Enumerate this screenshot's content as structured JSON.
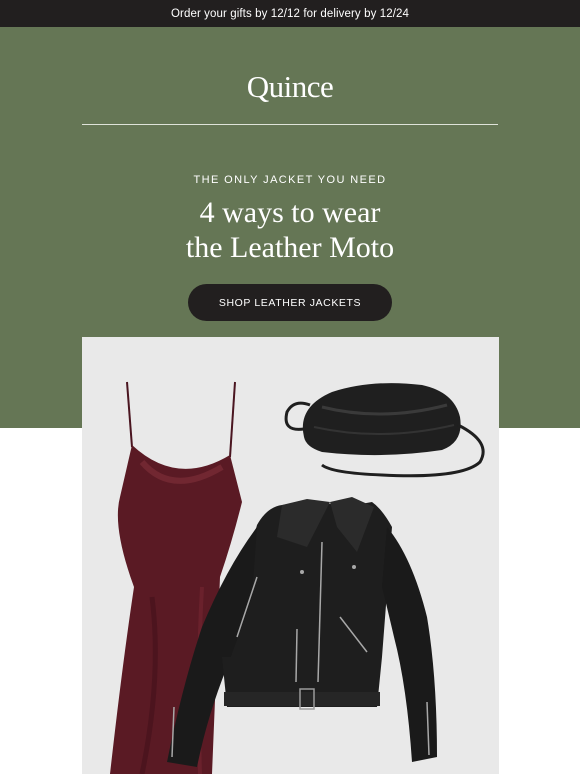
{
  "announcement": {
    "text": "Order your gifts by 12/12 for delivery by 12/24"
  },
  "brand": {
    "logo_text": "Quince"
  },
  "hero": {
    "eyebrow": "THE ONLY JACKET YOU NEED",
    "headline_line1": "4 ways to wear",
    "headline_line2": "the Leather Moto",
    "cta_label": "SHOP LEATHER JACKETS"
  },
  "colors": {
    "announcement_bg": "#221f1f",
    "hero_bg": "#657655",
    "cta_bg": "#221f1f",
    "image_bg": "#e9e9e9",
    "dress": "#5a1a24",
    "leather": "#1e1e1e"
  },
  "product_image": {
    "items": [
      "burgundy-slip-dress",
      "black-leather-pouch-bag",
      "black-leather-moto-jacket"
    ]
  }
}
